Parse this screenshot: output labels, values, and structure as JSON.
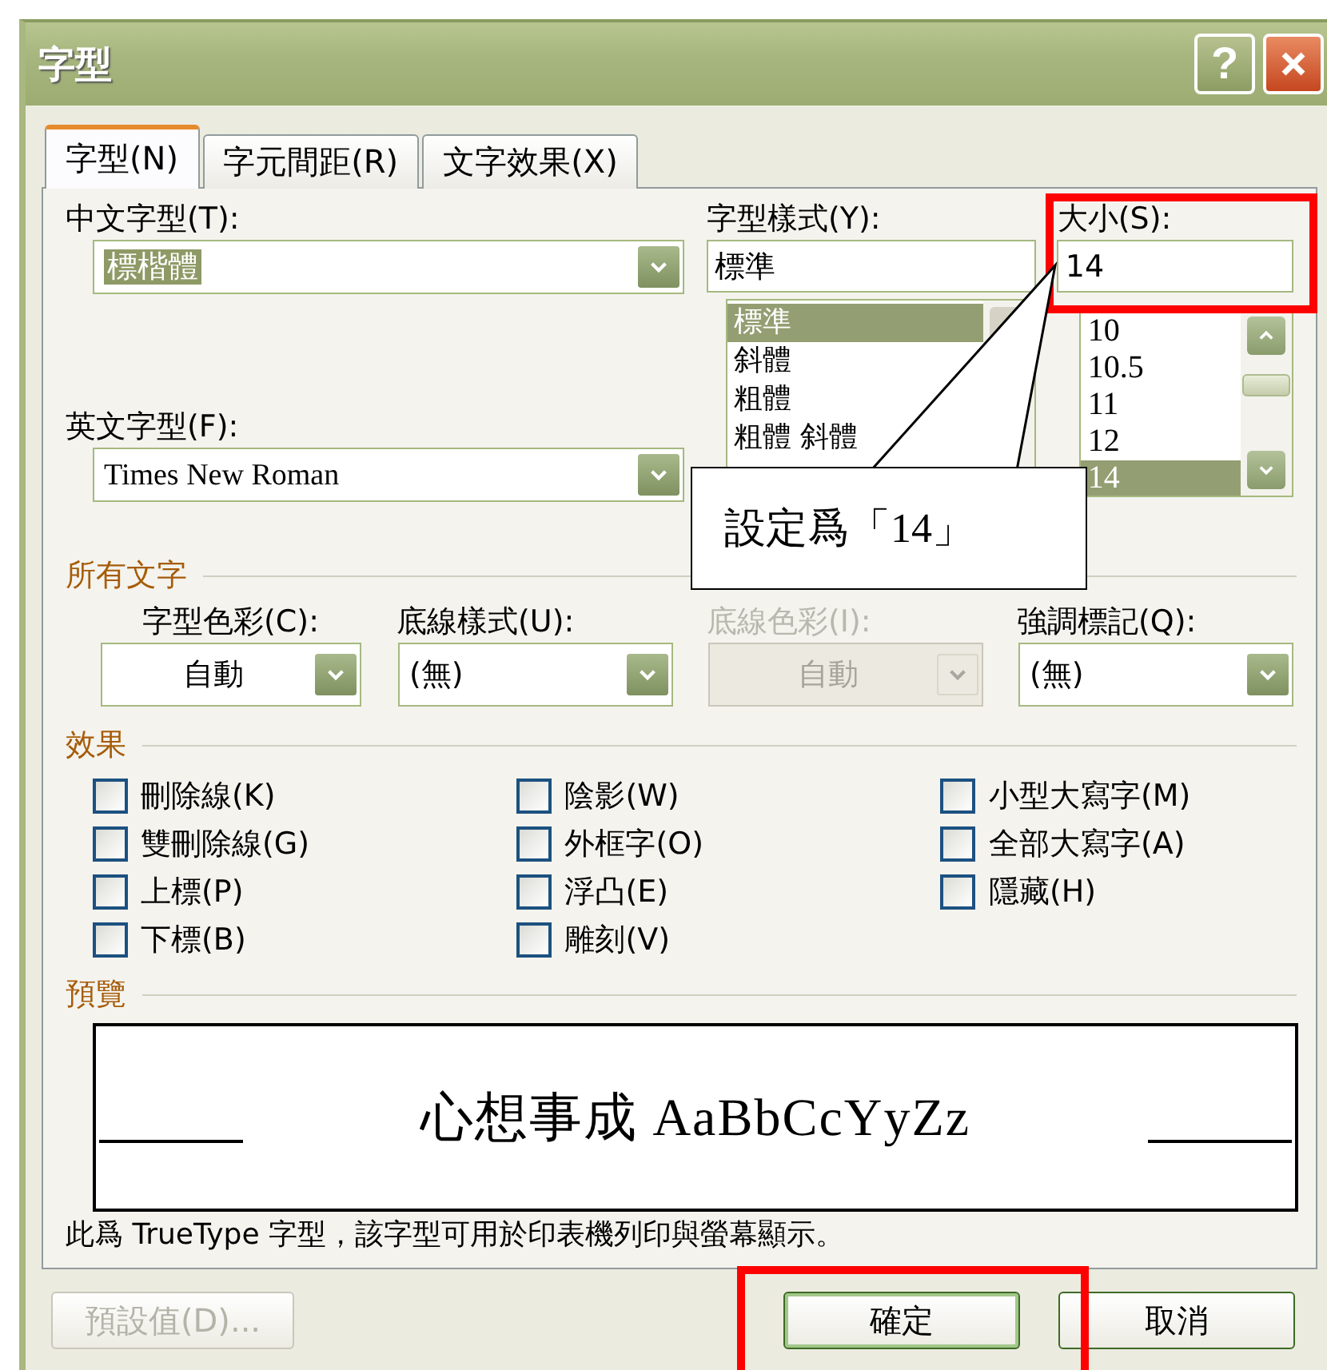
{
  "window": {
    "title": "字型",
    "help": "?"
  },
  "tabs": [
    {
      "label": "字型(N)",
      "selected": true
    },
    {
      "label": "字元間距(R)",
      "selected": false
    },
    {
      "label": "文字效果(X)",
      "selected": false
    }
  ],
  "chinese_font": {
    "label": "中文字型(T):",
    "value": "標楷體",
    "value_selected": true
  },
  "font_style": {
    "label": "字型樣式(Y):",
    "value": "標準",
    "options": [
      {
        "text": "標準",
        "selected": true
      },
      {
        "text": "斜體",
        "selected": false
      },
      {
        "text": "粗體",
        "selected": false
      },
      {
        "text": "粗體 斜體",
        "selected": false
      }
    ]
  },
  "size": {
    "label": "大小(S):",
    "value": "14",
    "options": [
      {
        "text": "10",
        "selected": false
      },
      {
        "text": "10.5",
        "selected": false
      },
      {
        "text": "11",
        "selected": false
      },
      {
        "text": "12",
        "selected": false
      },
      {
        "text": "14",
        "selected": true
      }
    ]
  },
  "english_font": {
    "label": "英文字型(F):",
    "value": "Times New Roman"
  },
  "all_text": {
    "title": "所有文字",
    "fields": [
      {
        "label": "字型色彩(C):",
        "value": "自動",
        "disabled": false,
        "centered": true
      },
      {
        "label": "底線樣式(U):",
        "value": "(無)",
        "disabled": false,
        "centered": false
      },
      {
        "label": "底線色彩(I):",
        "value": "自動",
        "disabled": true,
        "centered": true
      },
      {
        "label": "強調標記(Q):",
        "value": "(無)",
        "disabled": false,
        "centered": false
      }
    ]
  },
  "effects": {
    "title": "效果",
    "columns": [
      [
        {
          "label": "刪除線(K)",
          "checked": false
        },
        {
          "label": "雙刪除線(G)",
          "checked": false
        },
        {
          "label": "上標(P)",
          "checked": false
        },
        {
          "label": "下標(B)",
          "checked": false
        }
      ],
      [
        {
          "label": "陰影(W)",
          "checked": false
        },
        {
          "label": "外框字(O)",
          "checked": false
        },
        {
          "label": "浮凸(E)",
          "checked": false
        },
        {
          "label": "雕刻(V)",
          "checked": false
        }
      ],
      [
        {
          "label": "小型大寫字(M)",
          "checked": false
        },
        {
          "label": "全部大寫字(A)",
          "checked": false
        },
        {
          "label": "隱藏(H)",
          "checked": false
        }
      ]
    ]
  },
  "preview": {
    "title": "預覽",
    "sample": "心想事成 AaBbCcYyZz"
  },
  "info": "此爲 TrueType 字型，該字型可用於印表機列印與螢幕顯示。",
  "buttons": [
    {
      "label": "預設值(D)...",
      "disabled": true,
      "default": false
    },
    {
      "label": "確定",
      "disabled": false,
      "default": true
    },
    {
      "label": "取消",
      "disabled": false,
      "default": false
    }
  ],
  "callout": {
    "text": "設定爲「14」"
  }
}
